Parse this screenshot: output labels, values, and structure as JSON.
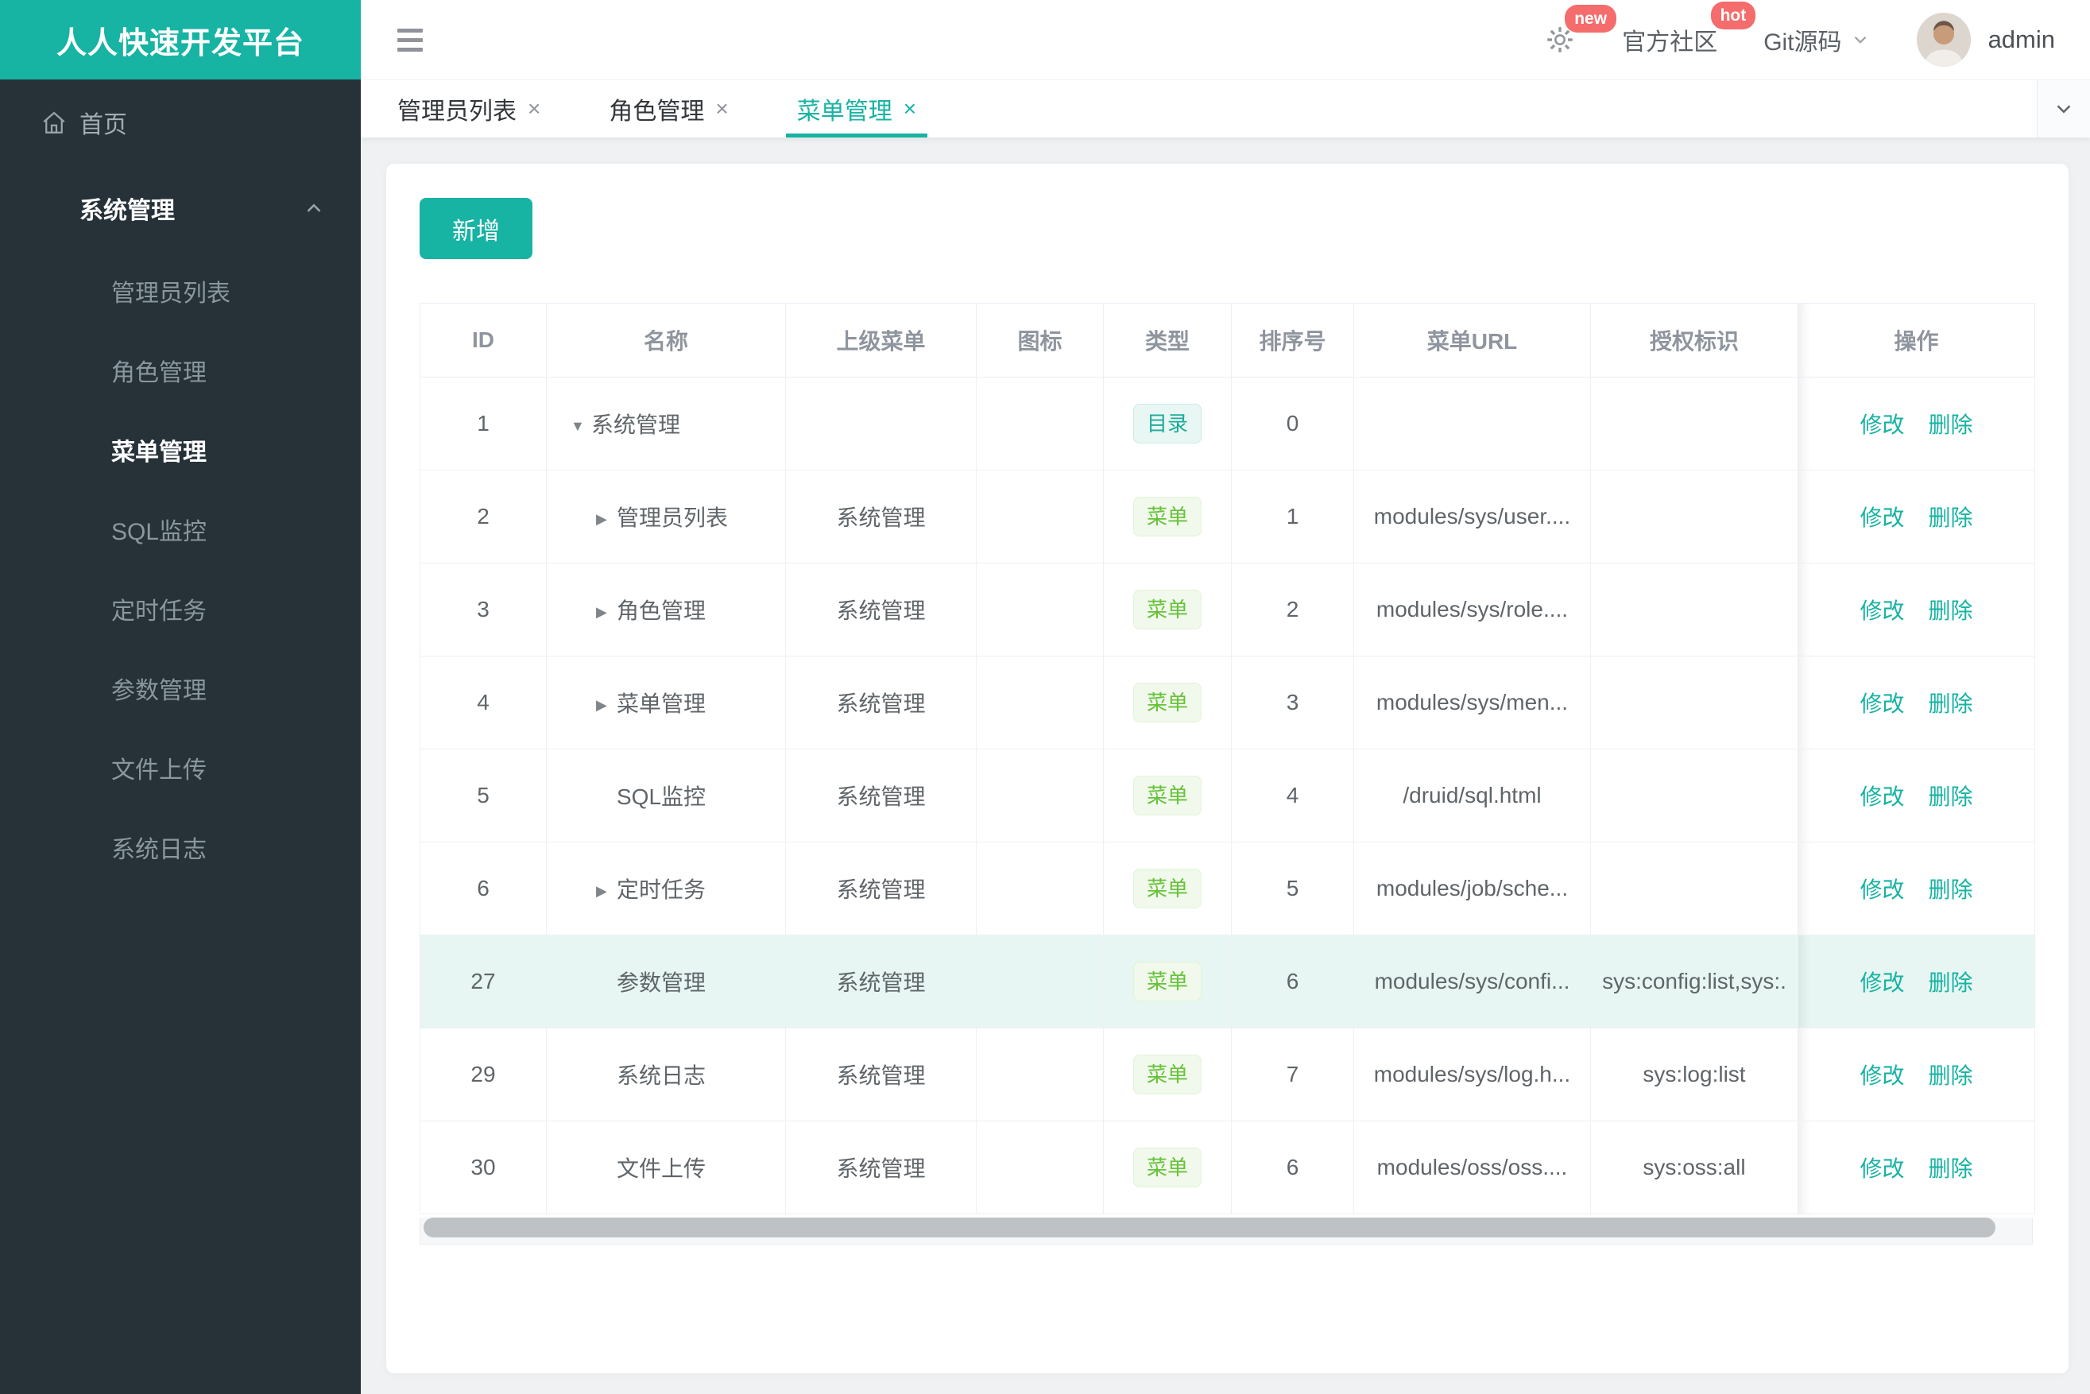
{
  "app": {
    "title": "人人快速开发平台"
  },
  "topbar": {
    "badge_new": "new",
    "badge_hot": "hot",
    "community_label": "官方社区",
    "git_label": "Git源码",
    "username": "admin",
    "icons": {
      "menu": "hamburger",
      "settings": "gear",
      "git_caret": "chevron-down",
      "user": "avatar-photo"
    }
  },
  "sidebar": {
    "home_label": "首页",
    "group_label": "系统管理",
    "items": [
      "管理员列表",
      "角色管理",
      "菜单管理",
      "SQL监控",
      "定时任务",
      "参数管理",
      "文件上传",
      "系统日志"
    ],
    "active_item": "菜单管理"
  },
  "tabs": [
    {
      "label": "管理员列表",
      "active": false
    },
    {
      "label": "角色管理",
      "active": false
    },
    {
      "label": "菜单管理",
      "active": true
    }
  ],
  "toolbar": {
    "add_label": "新增"
  },
  "table": {
    "columns": [
      "ID",
      "名称",
      "上级菜单",
      "图标",
      "类型",
      "排序号",
      "菜单URL",
      "授权标识",
      "操作"
    ],
    "action_labels": {
      "edit": "修改",
      "remove": "删除"
    },
    "type_styles": {
      "目录": "dir",
      "菜单": "menu"
    },
    "rows": [
      {
        "id": "1",
        "arrow": "down",
        "level": 0,
        "name": "系统管理",
        "parent": "",
        "icon": "",
        "type": "目录",
        "sort": "0",
        "url": "",
        "auth": "",
        "highlighted": false
      },
      {
        "id": "2",
        "arrow": "right",
        "level": 1,
        "name": "管理员列表",
        "parent": "系统管理",
        "icon": "",
        "type": "菜单",
        "sort": "1",
        "url": "modules/sys/user....",
        "auth": "",
        "highlighted": false
      },
      {
        "id": "3",
        "arrow": "right",
        "level": 1,
        "name": "角色管理",
        "parent": "系统管理",
        "icon": "",
        "type": "菜单",
        "sort": "2",
        "url": "modules/sys/role....",
        "auth": "",
        "highlighted": false
      },
      {
        "id": "4",
        "arrow": "right",
        "level": 1,
        "name": "菜单管理",
        "parent": "系统管理",
        "icon": "",
        "type": "菜单",
        "sort": "3",
        "url": "modules/sys/men...",
        "auth": "",
        "highlighted": false
      },
      {
        "id": "5",
        "arrow": "none",
        "level": 1,
        "name": "SQL监控",
        "parent": "系统管理",
        "icon": "",
        "type": "菜单",
        "sort": "4",
        "url": "/druid/sql.html",
        "auth": "",
        "highlighted": false
      },
      {
        "id": "6",
        "arrow": "right",
        "level": 1,
        "name": "定时任务",
        "parent": "系统管理",
        "icon": "",
        "type": "菜单",
        "sort": "5",
        "url": "modules/job/sche...",
        "auth": "",
        "highlighted": false
      },
      {
        "id": "27",
        "arrow": "none",
        "level": 1,
        "name": "参数管理",
        "parent": "系统管理",
        "icon": "",
        "type": "菜单",
        "sort": "6",
        "url": "modules/sys/confi...",
        "auth": "sys:config:list,sys:.",
        "highlighted": true
      },
      {
        "id": "29",
        "arrow": "none",
        "level": 1,
        "name": "系统日志",
        "parent": "系统管理",
        "icon": "",
        "type": "菜单",
        "sort": "7",
        "url": "modules/sys/log.h...",
        "auth": "sys:log:list",
        "highlighted": false
      },
      {
        "id": "30",
        "arrow": "none",
        "level": 1,
        "name": "文件上传",
        "parent": "系统管理",
        "icon": "",
        "type": "菜单",
        "sort": "6",
        "url": "modules/oss/oss....",
        "auth": "sys:oss:all",
        "highlighted": false
      }
    ]
  },
  "colors": {
    "primary": "#17b3a3",
    "tag_menu_green": "#67c23a",
    "badge_red": "#f56c6c",
    "sidebar_bg": "#263238",
    "row_highlight": "#e7f6f2"
  }
}
